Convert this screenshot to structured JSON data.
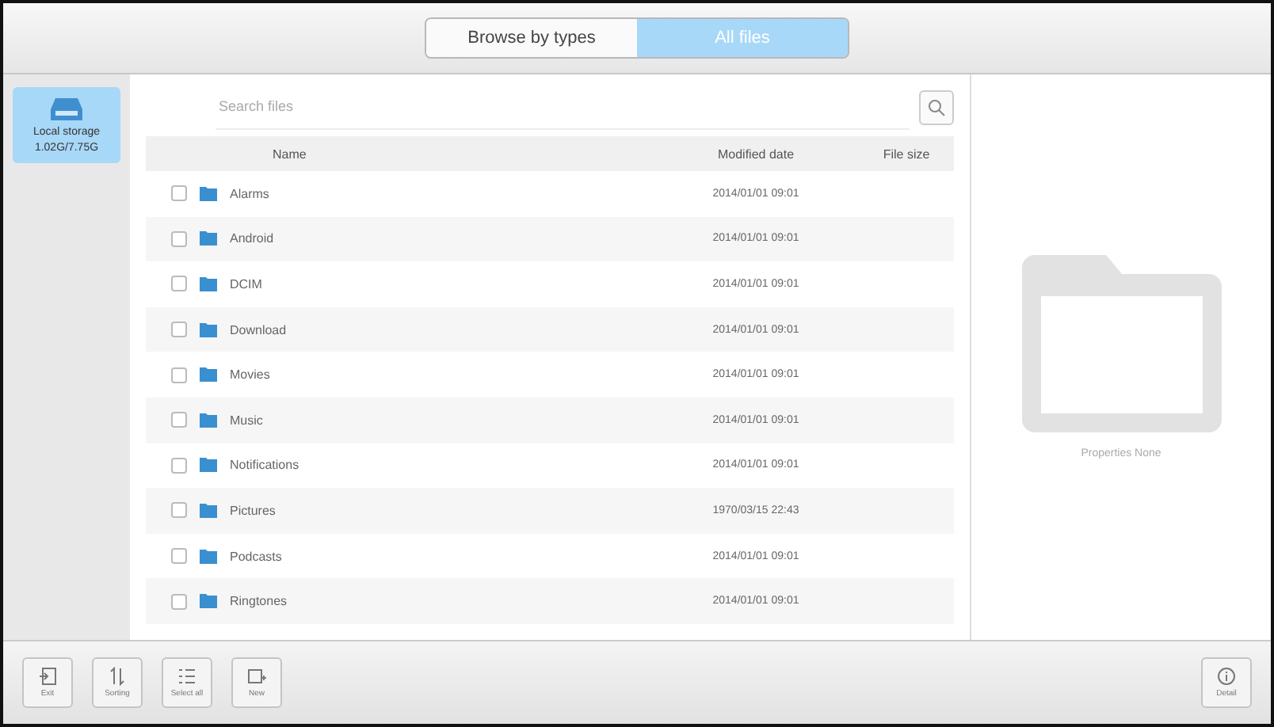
{
  "tabs": [
    {
      "label": "Browse by types",
      "selected": false
    },
    {
      "label": "All files",
      "selected": true
    }
  ],
  "sidebar": {
    "items": [
      {
        "label": "Local storage",
        "usage": "1.02G/7.75G",
        "selected": true
      }
    ]
  },
  "search": {
    "placeholder": "Search files"
  },
  "table": {
    "columns": [
      "Name",
      "Modified date",
      "File size"
    ],
    "rows": [
      {
        "name": "Alarms",
        "date": "2014/01/01 09:01",
        "checked": false
      },
      {
        "name": "Android",
        "date": "2014/01/01 09:01",
        "checked": false
      },
      {
        "name": "DCIM",
        "date": "2014/01/01 09:01",
        "checked": false
      },
      {
        "name": "Download",
        "date": "2014/01/01 09:01",
        "checked": false
      },
      {
        "name": "Movies",
        "date": "2014/01/01 09:01",
        "checked": false
      },
      {
        "name": "Music",
        "date": "2014/01/01 09:01",
        "checked": false
      },
      {
        "name": "Notifications",
        "date": "2014/01/01 09:01",
        "checked": false
      },
      {
        "name": "Pictures",
        "date": "1970/03/15 22:43",
        "checked": false
      },
      {
        "name": "Podcasts",
        "date": "2014/01/01 09:01",
        "checked": false
      },
      {
        "name": "Ringtones",
        "date": "2014/01/01 09:01",
        "checked": false
      }
    ]
  },
  "properties": {
    "label": "Properties None"
  },
  "toolbar": {
    "left": [
      {
        "kind": "exit",
        "label": "Exit"
      },
      {
        "kind": "sort",
        "label": "Sorting"
      },
      {
        "kind": "select",
        "label": "Select all"
      },
      {
        "kind": "new",
        "label": "New"
      }
    ],
    "right": [
      {
        "kind": "detail",
        "label": "Detail"
      }
    ]
  }
}
